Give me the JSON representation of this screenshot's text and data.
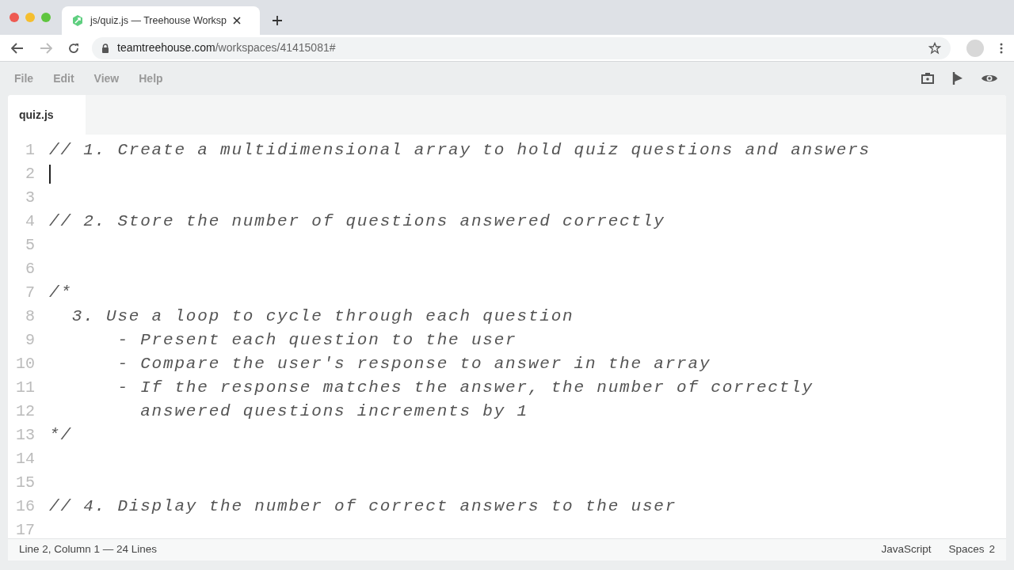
{
  "browser": {
    "tab_title": "js/quiz.js — Treehouse Worksp",
    "url_host": "teamtreehouse.com",
    "url_path": "/workspaces/41415081#"
  },
  "menu": [
    "File",
    "Edit",
    "View",
    "Help"
  ],
  "editor_tabs": [
    {
      "label": "quiz.js",
      "selected": true
    }
  ],
  "lines": [
    {
      "number": "1",
      "text": "// 1. Create a multidimensional array to hold quiz questions and answers",
      "cursor": false
    },
    {
      "number": "2",
      "cursor": true
    },
    {
      "number": "3",
      "cursor": false
    },
    {
      "number": "4",
      "text": "// 2. Store the number of questions answered correctly",
      "cursor": false
    },
    {
      "number": "5",
      "cursor": false
    },
    {
      "number": "6",
      "cursor": false
    },
    {
      "number": "7",
      "text": "/*",
      "cursor": false
    },
    {
      "number": "8",
      "text": "  3. Use a loop to cycle through each question",
      "cursor": false
    },
    {
      "number": "9",
      "text": "      - Present each question to the user",
      "cursor": false
    },
    {
      "number": "10",
      "text": "      - Compare the user's response to answer in the array",
      "cursor": false
    },
    {
      "number": "11",
      "text": "      - If the response matches the answer, the number of correctly",
      "cursor": false
    },
    {
      "number": "12",
      "text": "        answered questions increments by 1",
      "cursor": false
    },
    {
      "number": "13",
      "text": "*/",
      "cursor": false
    },
    {
      "number": "14",
      "cursor": false
    },
    {
      "number": "15",
      "cursor": false
    },
    {
      "number": "16",
      "text": "// 4. Display the number of correct answers to the user",
      "cursor": false
    },
    {
      "number": "17",
      "cursor": false
    }
  ],
  "status_bar": {
    "position": "Line 2, Column 1 — 24 Lines",
    "language": "JavaScript",
    "indent_label": "Spaces",
    "indent_size": "2"
  }
}
